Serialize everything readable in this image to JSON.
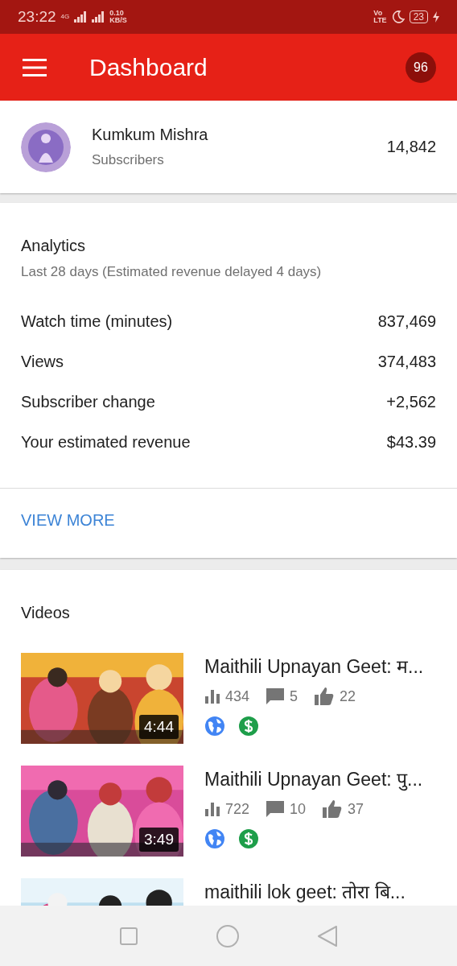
{
  "status_bar": {
    "time": "23:22",
    "network": "4G",
    "speed": "0.10",
    "speed_unit": "KB/S",
    "volte_top": "Vo",
    "volte_bottom": "LTE",
    "battery": "23"
  },
  "app_bar": {
    "title": "Dashboard",
    "badge": "96"
  },
  "channel": {
    "name": "Kumkum Mishra",
    "label": "Subscribers",
    "count": "14,842"
  },
  "analytics": {
    "title": "Analytics",
    "subtitle": "Last 28 days (Estimated revenue delayed 4 days)",
    "rows": [
      {
        "label": "Watch time (minutes)",
        "value": "837,469"
      },
      {
        "label": "Views",
        "value": "374,483"
      },
      {
        "label": "Subscriber change",
        "value": "+2,562"
      },
      {
        "label": "Your estimated revenue",
        "value": "$43.39"
      }
    ],
    "link": "VIEW MORE"
  },
  "videos": {
    "title": "Videos",
    "items": [
      {
        "duration": "4:44",
        "title": "Maithili Upnayan Geet: म...",
        "views": "434",
        "comments": "5",
        "likes": "22",
        "public": true,
        "monetized": true
      },
      {
        "duration": "3:49",
        "title": "Maithili Upnayan Geet: पु...",
        "views": "722",
        "comments": "10",
        "likes": "37",
        "public": true,
        "monetized": true
      },
      {
        "title": "maithili lok geet:  तोरा बि..."
      }
    ]
  }
}
